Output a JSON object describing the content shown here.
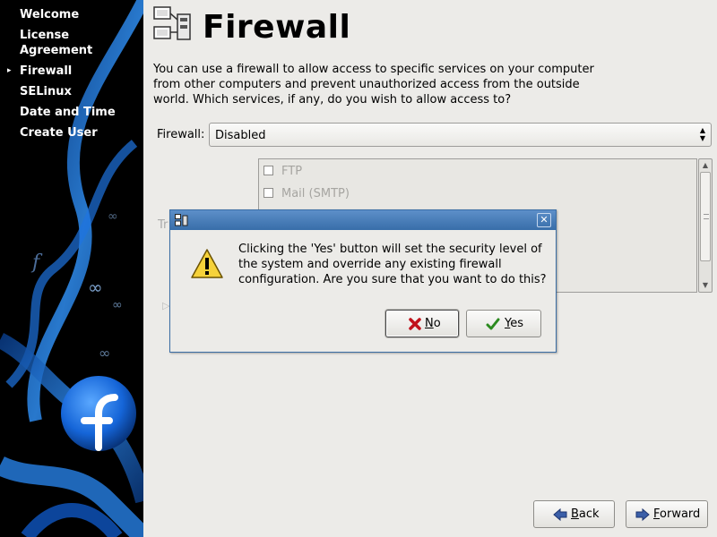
{
  "sidebar": {
    "steps": [
      {
        "label": "Welcome",
        "current": false
      },
      {
        "label": "License Agreement",
        "current": false
      },
      {
        "label": "Firewall",
        "current": true
      },
      {
        "label": "SELinux",
        "current": false
      },
      {
        "label": "Date and Time",
        "current": false
      },
      {
        "label": "Create User",
        "current": false
      }
    ],
    "current_marker": "▸"
  },
  "page": {
    "title": "Firewall",
    "description": "You can use a firewall to allow access to specific services on your computer from other computers and prevent unauthorized access from the outside world.  Which services, if any, do you wish to allow access to?",
    "firewall_label": "Firewall:",
    "firewall_value": "Disabled",
    "trusted_label_partial": "Tr",
    "services": [
      {
        "label": "FTP",
        "checked": false
      },
      {
        "label": "Mail (SMTP)",
        "checked": false
      }
    ]
  },
  "nav": {
    "back_mnemonic": "B",
    "back_rest": "ack",
    "forward_mnemonic": "F",
    "forward_rest": "orward"
  },
  "dialog": {
    "message": "Clicking the 'Yes' button will set the security level of the system and override any existing firewall configuration.  Are you sure that you want to do this?",
    "no_mnemonic": "N",
    "no_rest": "o",
    "yes_mnemonic": "Y",
    "yes_rest": "es",
    "close_glyph": "✕"
  },
  "colors": {
    "titlebar": "#386ea9",
    "sidebar_bg": "#000000",
    "accent_blue": "#1f7be8"
  }
}
